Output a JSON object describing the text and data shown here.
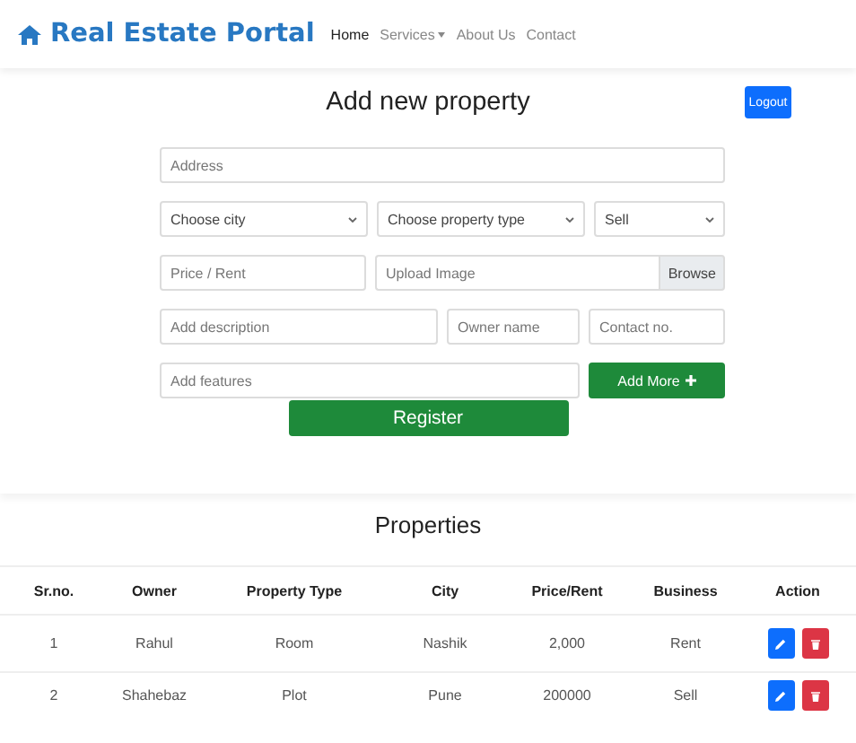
{
  "navbar": {
    "brand": "Real Estate Portal",
    "links": [
      {
        "label": "Home",
        "selected": true,
        "dropdown": false
      },
      {
        "label": "Services",
        "selected": false,
        "dropdown": true
      },
      {
        "label": "About Us",
        "selected": false,
        "dropdown": false
      },
      {
        "label": "Contact",
        "selected": false,
        "dropdown": false
      }
    ]
  },
  "logout_button": "Logout",
  "form": {
    "heading": "Add new property",
    "rows": [
      [
        {
          "kind": "input",
          "placeholder": "Address"
        }
      ],
      [
        {
          "kind": "select",
          "value": "Choose city"
        },
        {
          "kind": "select",
          "value": "Choose property type"
        },
        {
          "kind": "select",
          "value": "Sell"
        }
      ],
      [
        {
          "kind": "input",
          "placeholder": "Price / Rent"
        },
        {
          "kind": "file",
          "placeholder": "Upload Image",
          "button": "Browse"
        }
      ],
      [
        {
          "kind": "input",
          "placeholder": "Add description"
        },
        {
          "kind": "input",
          "placeholder": "Owner name"
        },
        {
          "kind": "input",
          "placeholder": "Contact no."
        }
      ],
      [
        {
          "kind": "input",
          "placeholder": "Add features"
        },
        {
          "kind": "button",
          "label": "Add More"
        }
      ]
    ],
    "submit_button": "Register"
  },
  "table": {
    "title": "Properties",
    "columns": [
      "Sr.no.",
      "Owner",
      "Property Type",
      "City",
      "Price/Rent",
      "Business",
      "Action"
    ],
    "rows": [
      [
        "1",
        "Rahul",
        "Room",
        "Nashik",
        "2,000",
        "Rent"
      ],
      [
        "2",
        "Shahebaz",
        "Plot",
        "Pune",
        "200000",
        "Sell"
      ]
    ]
  }
}
